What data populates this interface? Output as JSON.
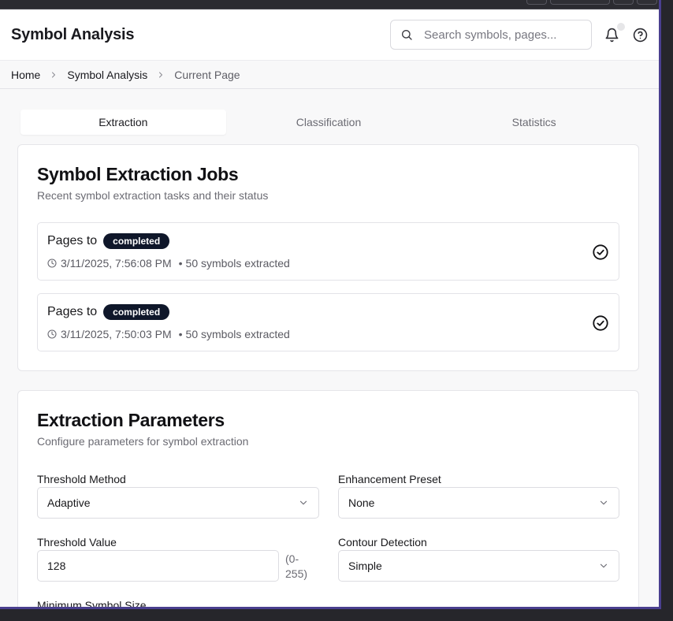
{
  "app": {
    "title": "Symbol Analysis",
    "search_placeholder": "Search symbols, pages..."
  },
  "breadcrumb": {
    "home": "Home",
    "section": "Symbol Analysis",
    "current": "Current Page"
  },
  "tabs": [
    {
      "label": "Extraction",
      "active": true
    },
    {
      "label": "Classification",
      "active": false
    },
    {
      "label": "Statistics",
      "active": false
    }
  ],
  "jobs_card": {
    "title": "Symbol Extraction Jobs",
    "subtitle": "Recent symbol extraction tasks and their status",
    "jobs": [
      {
        "name": "Pages to",
        "status": "completed",
        "timestamp": "3/11/2025, 7:56:08 PM",
        "separator": "•",
        "result": "50 symbols extracted"
      },
      {
        "name": "Pages to",
        "status": "completed",
        "timestamp": "3/11/2025, 7:50:03 PM",
        "separator": "•",
        "result": "50 symbols extracted"
      }
    ]
  },
  "params_card": {
    "title": "Extraction Parameters",
    "subtitle": "Configure parameters for symbol extraction",
    "threshold_method": {
      "label": "Threshold Method",
      "value": "Adaptive"
    },
    "enhancement_preset": {
      "label": "Enhancement Preset",
      "value": "None"
    },
    "threshold_value": {
      "label": "Threshold Value",
      "value": "128",
      "hint_line1": "(0-",
      "hint_line2": "255)"
    },
    "contour_detection": {
      "label": "Contour Detection",
      "value": "Simple"
    },
    "min_symbol_size": {
      "label": "Minimum Symbol Size"
    }
  },
  "icons": {
    "search": "search-icon",
    "bell": "bell-icon",
    "help": "help-circle-icon",
    "chevron_right": "chevron-right-icon",
    "chevron_down": "chevron-down-icon",
    "clock": "clock-icon",
    "check_circle": "check-circle-icon"
  },
  "colors": {
    "badge_bg": "#0f172a",
    "window_accent": "#4a3f8f"
  }
}
